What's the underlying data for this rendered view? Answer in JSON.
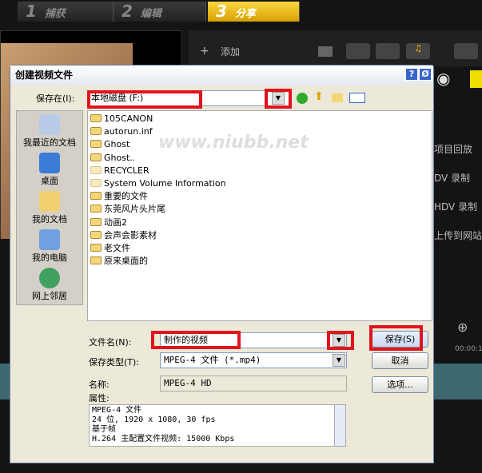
{
  "app_tabs": [
    {
      "num": "1",
      "label": "捕获"
    },
    {
      "num": "2",
      "label": "编辑"
    },
    {
      "num": "3",
      "label": "分享",
      "active": true
    }
  ],
  "library": {
    "add_label": "添加"
  },
  "share_menu": [
    "项目回放",
    "DV 录制",
    "HDV 录制",
    "上传到网站"
  ],
  "timeline": {
    "timecode": "00:00:1"
  },
  "dialog": {
    "title": "创建视频文件",
    "save_in_label": "保存在(I):",
    "save_in_value": "本地磁盘 (F:)",
    "places": [
      "我最近的文档",
      "桌面",
      "我的文档",
      "我的电脑",
      "网上邻居"
    ],
    "files": [
      "105CANON",
      "autorun.inf",
      "Ghost",
      "Ghost..",
      "RECYCLER",
      "System Volume Information",
      "重要的文件",
      "东莞风片头片尾",
      "动画2",
      "会声会影素材",
      "老文件",
      "原来桌面的"
    ],
    "filename_label": "文件名(N):",
    "filename_value": "制作的视频",
    "filetype_label": "保存类型(T):",
    "filetype_value": "MPEG-4 文件 (*.mp4)",
    "name_label": "名称:",
    "name_value": "MPEG-4 HD",
    "attributes_label": "属性:",
    "attributes": [
      "MPEG-4 文件",
      "24 位, 1920 x 1080, 30 fps",
      "基于帧",
      "H.264 主配置文件视频: 15000 Kbps"
    ],
    "save_button": "保存(S)",
    "cancel_button": "取消",
    "options_button": "选项...",
    "help_button": "?",
    "close_button": "Ø"
  },
  "watermark": "www.niubb.net"
}
